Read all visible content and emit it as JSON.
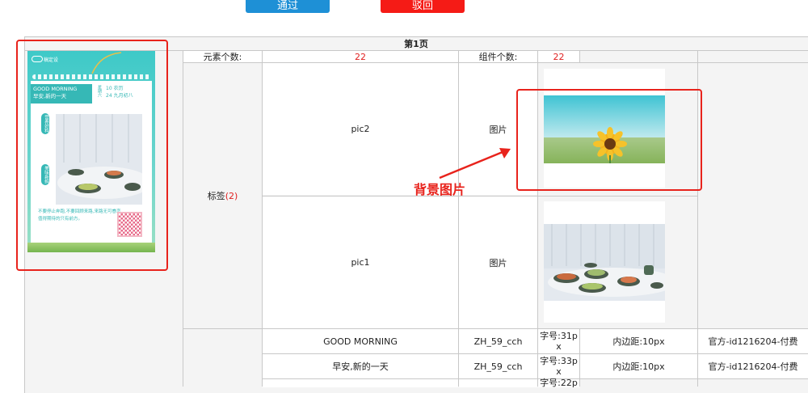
{
  "toolbar": {
    "pass_label": "通过",
    "reject_label": "驳回"
  },
  "page": {
    "title": "第1页"
  },
  "summary": {
    "elements_label": "元素个数:",
    "elements_value": "22",
    "components_label": "组件个数:",
    "components_value": "22"
  },
  "tag_group": {
    "label": "标签",
    "count": "(2)"
  },
  "images": [
    {
      "name": "pic2",
      "type": "图片"
    },
    {
      "name": "pic1",
      "type": "图片"
    }
  ],
  "annotation": {
    "text": "背景图片"
  },
  "text_rows": [
    {
      "content": "GOOD MORNING",
      "font": "ZH_59_cch",
      "size_label": "字号:",
      "size": "31p",
      "size_unit": "x",
      "padding": "内边距:10px",
      "source": "官方-id1216204-付费"
    },
    {
      "content": "早安,新的一天",
      "font": "ZH_59_cch",
      "size_label": "字号:",
      "size": "33p",
      "size_unit": "x",
      "padding": "内边距:10px",
      "source": "官方-id1216204-付费"
    },
    {
      "content": "",
      "font": "",
      "size_label": "字号:",
      "size": "22p",
      "size_unit": "",
      "padding": "",
      "source": ""
    }
  ],
  "poster": {
    "logo": "稿定设",
    "headline_en": "GOOD MORNING",
    "headline_zh": "早安,新的一天",
    "date_a": "星期六",
    "date_b": "10",
    "date_c": "24",
    "lunar_a": "农历",
    "lunar_b": "九月初八",
    "side_1": "营养好料",
    "side_2": "美味新鲜",
    "body": "不要停止奔跑,不要回顾来路,来路无可眷恋,值得期待的只有前方。"
  }
}
